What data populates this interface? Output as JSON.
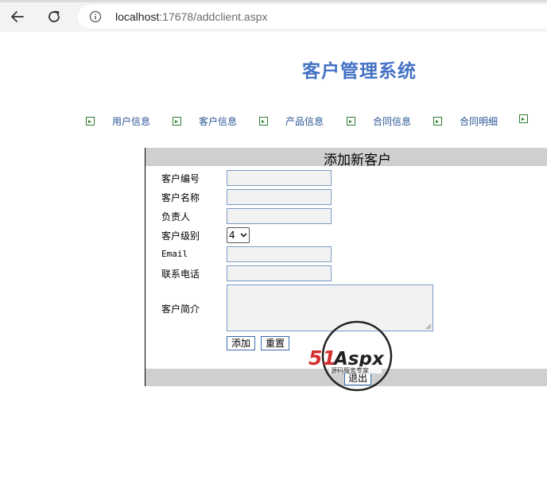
{
  "browser": {
    "url_host": "localhost",
    "url_rest": ":17678/addclient.aspx",
    "icons": {
      "back": "back-arrow-icon",
      "reload": "reload-icon",
      "info": "info-icon"
    }
  },
  "page": {
    "title": "客户管理系统",
    "menu": [
      {
        "label": "用户信息",
        "icon": "arrow-box-icon"
      },
      {
        "label": "客户信息",
        "icon": "arrow-box-icon"
      },
      {
        "label": "产品信息",
        "icon": "arrow-box-icon"
      },
      {
        "label": "合同信息",
        "icon": "arrow-box-icon"
      },
      {
        "label": "合同明细",
        "icon": "arrow-box-icon"
      }
    ],
    "form": {
      "heading": "添加新客户",
      "fields": {
        "client_no": {
          "label": "客户编号",
          "value": ""
        },
        "client_name": {
          "label": "客户名称",
          "value": ""
        },
        "owner": {
          "label": "负责人",
          "value": ""
        },
        "level": {
          "label": "客户级别",
          "value": "4"
        },
        "email": {
          "label": "Email",
          "value": ""
        },
        "phone": {
          "label": "联系电话",
          "value": ""
        },
        "intro": {
          "label": "客户简介",
          "value": ""
        }
      },
      "add_label": "添加",
      "reset_label": "重置",
      "logout_label": "退出"
    },
    "watermark": {
      "brand": "51Aspx",
      "tagline": "源码服务专家"
    },
    "colors": {
      "title": "#4472c4",
      "menu_link": "#2b5797",
      "menu_icon": "#2e7d32",
      "panel_bar": "#cfcfcf"
    }
  }
}
